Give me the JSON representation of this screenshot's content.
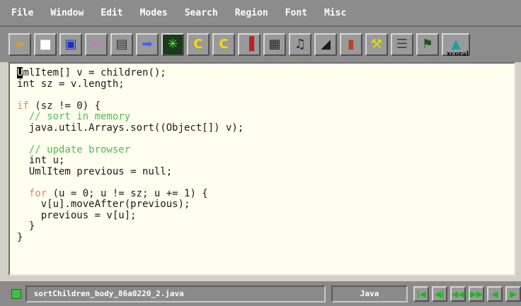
{
  "menubar": {
    "items": [
      "File",
      "Window",
      "Edit",
      "Modes",
      "Search",
      "Region",
      "Font",
      "Misc"
    ]
  },
  "toolbar": {
    "icons": [
      {
        "name": "open-folder-icon",
        "glyph": "📂"
      },
      {
        "name": "new-file-icon",
        "glyph": "▯"
      },
      {
        "name": "save-icon",
        "glyph": "▣"
      },
      {
        "name": "cut-icon",
        "glyph": "✂"
      },
      {
        "name": "paste-icon",
        "glyph": "▤"
      },
      {
        "name": "arrow-right-icon",
        "glyph": "➡"
      },
      {
        "name": "compile-icon",
        "glyph": "✳"
      },
      {
        "name": "c-icon",
        "glyph": "C"
      },
      {
        "name": "c-alt-icon",
        "glyph": "C"
      },
      {
        "name": "debug-icon",
        "glyph": "▐"
      },
      {
        "name": "doc-icon",
        "glyph": "▦"
      },
      {
        "name": "people-icon",
        "glyph": "♫"
      },
      {
        "name": "prism-icon",
        "glyph": "◢"
      },
      {
        "name": "door-icon",
        "glyph": "▮"
      },
      {
        "name": "tools-icon",
        "glyph": "⚒"
      },
      {
        "name": "list-icon",
        "glyph": "☰"
      },
      {
        "name": "sign-icon",
        "glyph": "⚑"
      }
    ],
    "last_label": "xcoral"
  },
  "editor": {
    "lines": [
      "UmlItem[] v = children();",
      "int sz = v.length;",
      "",
      "if (sz != 0) {",
      "  // sort in memory",
      "  java.util.Arrays.sort((Object[]) v);",
      "",
      "  // update browser",
      "  int u;",
      "  UmlItem previous = null;",
      "",
      "  for (u = 0; u != sz; u += 1) {",
      "    v[u].moveAfter(previous);",
      "    previous = v[u];",
      "  }",
      "}"
    ]
  },
  "status": {
    "filename": "sortChildren_body_86a0220_2.java",
    "mode": "Java",
    "nav": [
      "|◀",
      "◀|",
      "◀◀",
      "▶▶",
      "◀",
      "▶"
    ]
  },
  "colors": {
    "keyword": "#e08a5a",
    "comment": "#4cbf4c",
    "background": "#fffff0"
  }
}
